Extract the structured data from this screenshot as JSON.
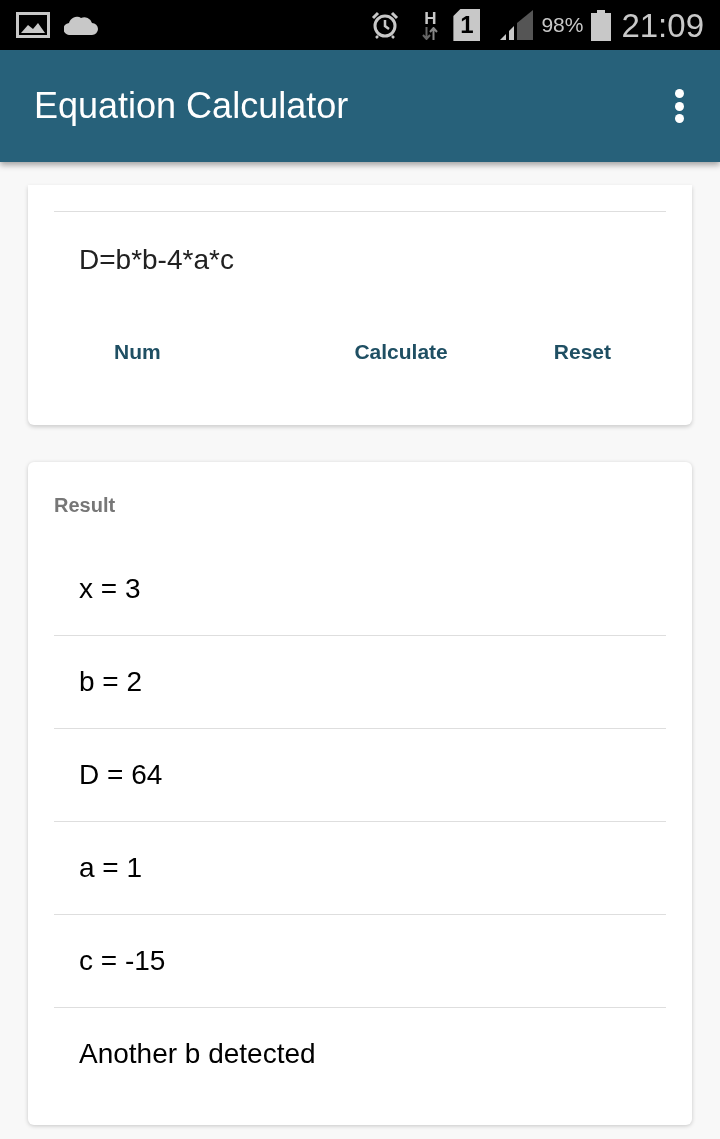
{
  "status_bar": {
    "network_type": "H",
    "sim_slot": "1",
    "battery": "98%",
    "time": "21:09"
  },
  "app_bar": {
    "title": "Equation Calculator"
  },
  "equation_card": {
    "formula": "D=b*b-4*a*c",
    "buttons": [
      "Num",
      "Calculate",
      "Reset"
    ]
  },
  "result_card": {
    "heading": "Result",
    "lines": [
      "x = 3",
      "b = 2",
      "D = 64",
      "a = 1",
      "c = -15",
      "Another b detected"
    ]
  }
}
